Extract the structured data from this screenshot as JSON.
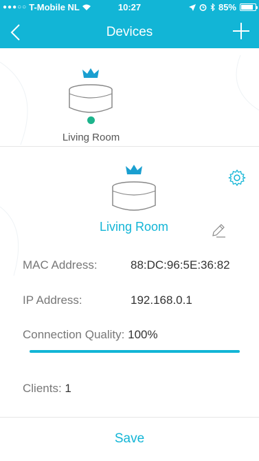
{
  "status_bar": {
    "signal": "●●●○○",
    "carrier": "T-Mobile NL",
    "time": "10:27",
    "battery": "85%",
    "battery_level": 0.85
  },
  "nav": {
    "title": "Devices",
    "back_icon": "chevron-left-icon",
    "add_icon": "plus-icon"
  },
  "gateway": {
    "label": "Living Room",
    "status_color": "#1db48c"
  },
  "device": {
    "name": "Living Room",
    "mac_label": "MAC Address:",
    "mac_value": "88:DC:96:5E:36:82",
    "ip_label": "IP Address:",
    "ip_value": "192.168.0.1",
    "quality_label": "Connection Quality:",
    "quality_value": "100%",
    "quality_level": 1.0,
    "clients_label": "Clients:",
    "clients_value": "1"
  },
  "footer": {
    "save_label": "Save"
  },
  "colors": {
    "accent": "#12b5d6",
    "crown": "#1a9fd0",
    "online": "#1db48c"
  }
}
